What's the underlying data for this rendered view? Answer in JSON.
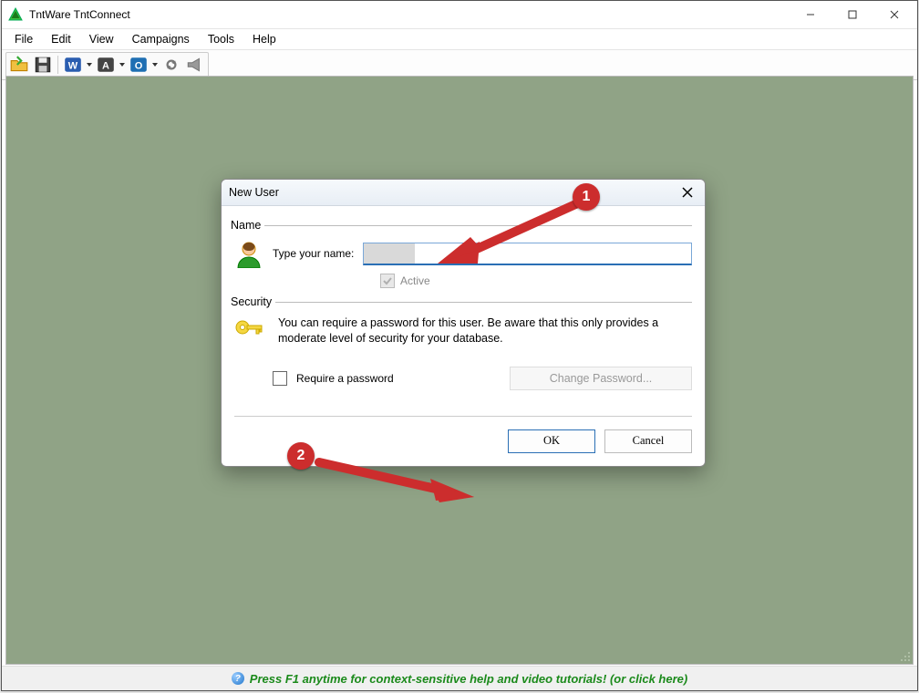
{
  "app": {
    "title": "TntWare TntConnect"
  },
  "menu": {
    "items": [
      "File",
      "Edit",
      "View",
      "Campaigns",
      "Tools",
      "Help"
    ]
  },
  "status": {
    "help_text": "Press F1 anytime for context-sensitive help and video tutorials!  (or click here)"
  },
  "dialog": {
    "title": "New User",
    "name_group": "Name",
    "name_label": "Type your name:",
    "name_value": "",
    "active_label": "Active",
    "security_group": "Security",
    "security_text": "You can require a password for this user.  Be aware that this only provides a moderate level of security for your database.",
    "require_pw_label": "Require a password",
    "change_pw_label": "Change Password...",
    "ok": "OK",
    "cancel": "Cancel"
  },
  "annot": {
    "b1": "1",
    "b2": "2"
  }
}
